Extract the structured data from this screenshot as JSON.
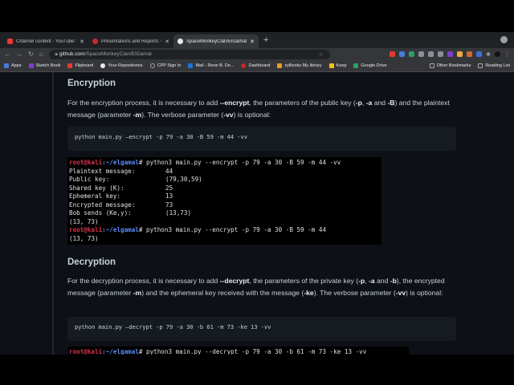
{
  "tabs": [
    {
      "title": "Channel content - YouTube Studio",
      "color": "#e53935"
    },
    {
      "title": "Presentations and Reports: CPP",
      "color": "#c62828"
    },
    {
      "title": "SpaceMonkeyClan/ElGamal: ElGamal",
      "color": "#e8eaed"
    }
  ],
  "url": {
    "host": "github.com",
    "path": "/SpaceMonkeyClan/ElGamal"
  },
  "bookmarks": [
    "Apps",
    "Sketch Book",
    "Flipboard",
    "Your Repositories",
    "CPP Sign In",
    "Mail - Rene B. De...",
    "Dashboard",
    "zyBooks My library",
    "Keep",
    "Google Drive"
  ],
  "bookmarks_right": [
    "Other Bookmarks",
    "Reading List"
  ],
  "enc": {
    "heading": "Encryption",
    "p": [
      "For the encryption process, it is necessary to add ",
      "--encrypt",
      ", the parameters of the public key (",
      "-p",
      ", ",
      "-a",
      " and ",
      "-B",
      ") and the plaintext message (parameter ",
      "-m",
      "). The verbose parameter (",
      "-vv",
      ") is optional:"
    ],
    "code": "python main.py —encrypt -p 79 -a 30 -B 59 -m 44 -vv",
    "prompt_user": "root@kali",
    "prompt_path": ":~/elgamal",
    "cmd1": "# python3 main.py --encrypt -p 79 -a 30 -B 59 -m 44 -vv",
    "rows": [
      [
        "Plaintext message:",
        "44"
      ],
      [
        "Public key:",
        "(79,30,59)"
      ],
      [
        "Shared key (K):",
        "25"
      ],
      [
        "Ephemeral key:",
        "13"
      ],
      [
        "Encrypted message:",
        "73"
      ],
      [
        "Bob sends (Ke,y):",
        "(13,73)"
      ]
    ],
    "out1": "(13, 73)",
    "cmd2": "# python3 main.py --encrypt -p 79 -a 30 -B 59 -m 44",
    "out2": "(13, 73)"
  },
  "dec": {
    "heading": "Decryption",
    "p": [
      "For the decryption process, it is necessary to add ",
      "--decrypt",
      ", the parameters of the private key (",
      "-p",
      ", ",
      "-a",
      " and ",
      "-b",
      "), the encrypted message (parameter ",
      "-m",
      ") and the ephemeral key received with the message (",
      "-ke",
      "). The verbose parameter (",
      "-vv",
      ") is optional:"
    ],
    "code": "python main.py —decrypt -p 79 -a 30 -b 61 -m 73 -ke 13 -vv",
    "cmd1": "# python3 main.py --decrypt -p 79 -a 30 -b 61 -m 73 -ke 13 -vv"
  }
}
